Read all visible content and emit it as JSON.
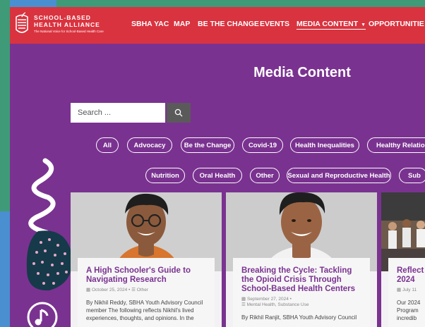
{
  "colors": {
    "header": "#d9333f",
    "page": "#7a3290",
    "accent": "#7a3290",
    "green": "#3f9a78",
    "blue": "#4a8fd0"
  },
  "logo": {
    "line1": "SCHOOL-BASED",
    "line2": "HEALTH ALLIANCE",
    "tagline": "The National Voice for School-Based Health Care"
  },
  "nav": [
    {
      "label": "SBHA YAC"
    },
    {
      "label": "MAP"
    },
    {
      "label": "BE THE CHANGE"
    },
    {
      "label": "EVENTS"
    },
    {
      "label": "MEDIA CONTENT",
      "active": true,
      "caret": "▼"
    },
    {
      "label": "OPPORTUNITIE"
    }
  ],
  "page_title": "Media Content",
  "search": {
    "placeholder": "Search ...",
    "icon": "search-icon"
  },
  "filters_row1": [
    "All",
    "Advocacy",
    "Be the Change",
    "Covid-19",
    "Health Inequalities",
    "Healthy Relation"
  ],
  "filters_row2": [
    "Nutrition",
    "Oral Health",
    "Other",
    "Sexual and Reproductive Health",
    "Sub"
  ],
  "cards": [
    {
      "title": "A High Schooler's Guide to Navigating Research",
      "date": "October 25, 2024",
      "tags": "Other",
      "excerpt": "By Nikhil Reddy, SBHA Youth Advisory Council member The following reflects Nikhil's lived experiences, thoughts, and opinions. In the"
    },
    {
      "title": "Breaking the Cycle: Tackling the Opioid Crisis Through School-Based Health Centers",
      "date": "September 27, 2024",
      "tags": "Mental Health, Substance Use",
      "excerpt": "By Rikhil Ranjit, SBHA Youth Advisory Council"
    },
    {
      "title": "Reflect 2024",
      "date": "July 11",
      "tags": "",
      "excerpt": "Our 2024 Program incredib"
    }
  ]
}
